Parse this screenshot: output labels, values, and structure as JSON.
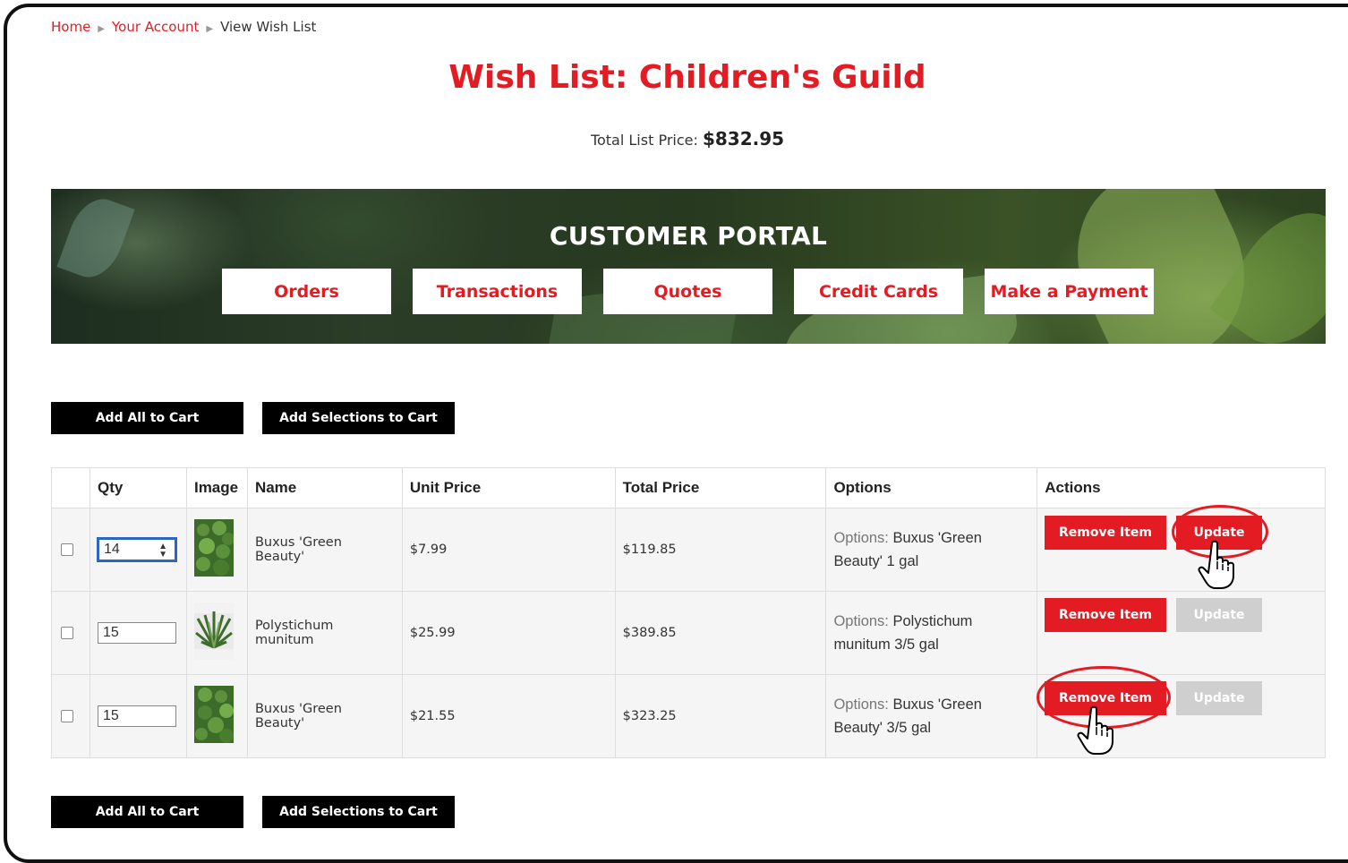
{
  "breadcrumb": {
    "home": "Home",
    "account": "Your Account",
    "current": "View Wish List"
  },
  "page": {
    "title": "Wish List: Children's Guild",
    "total_label": "Total List Price:",
    "total_value": "$832.95"
  },
  "portal": {
    "title": "CUSTOMER PORTAL",
    "nav": [
      "Orders",
      "Transactions",
      "Quotes",
      "Credit Cards",
      "Make a Payment"
    ]
  },
  "cart_actions": {
    "add_all": "Add All to Cart",
    "add_selections": "Add Selections to Cart"
  },
  "table": {
    "headers": [
      "",
      "Qty",
      "Image",
      "Name",
      "Unit Price",
      "Total Price",
      "Options",
      "Actions"
    ],
    "rows": [
      {
        "qty": "14",
        "name": "Buxus 'Green Beauty'",
        "unit_price": "$7.99",
        "total_price": "$119.85",
        "options_label": "Options:",
        "options_value": "Buxus 'Green Beauty' 1 gal",
        "remove_label": "Remove Item",
        "update_label": "Update",
        "update_enabled": true
      },
      {
        "qty": "15",
        "name": "Polystichum munitum",
        "unit_price": "$25.99",
        "total_price": "$389.85",
        "options_label": "Options:",
        "options_value": "Polystichum munitum 3/5 gal",
        "remove_label": "Remove Item",
        "update_label": "Update",
        "update_enabled": false
      },
      {
        "qty": "15",
        "name": "Buxus 'Green Beauty'",
        "unit_price": "$21.55",
        "total_price": "$323.25",
        "options_label": "Options:",
        "options_value": "Buxus 'Green Beauty' 3/5 gal",
        "remove_label": "Remove Item",
        "update_label": "Update",
        "update_enabled": false
      }
    ]
  },
  "colors": {
    "brand_red": "#e31b23",
    "button_black": "#000000",
    "disabled_grey": "#cfcfcf"
  },
  "icons": [
    "caret-right-icon",
    "spinner-arrows-icon",
    "hand-pointer-icon"
  ]
}
